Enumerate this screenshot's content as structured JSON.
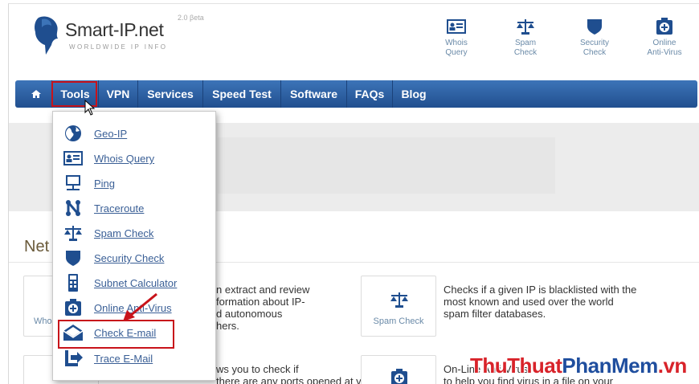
{
  "header": {
    "logo_title": "Smart-IP.net",
    "logo_subtitle": "WORLDWIDE IP INFO",
    "version": "2.0 βeta",
    "links": [
      {
        "label_line1": "Whois",
        "label_line2": "Query",
        "icon": "id-card-icon"
      },
      {
        "label_line1": "Spam",
        "label_line2": "Check",
        "icon": "scales-icon"
      },
      {
        "label_line1": "Security",
        "label_line2": "Check",
        "icon": "shield-icon"
      },
      {
        "label_line1": "Online",
        "label_line2": "Anti-Virus",
        "icon": "virus-scan-icon"
      }
    ]
  },
  "nav": {
    "home_icon": "home-icon",
    "items": [
      "Tools",
      "VPN",
      "Services",
      "Speed Test",
      "Software",
      "FAQs",
      "Blog"
    ]
  },
  "page": {
    "section_title": "Net",
    "box1_label": "Who",
    "desc1": [
      "n extract and review",
      "formation about IP-",
      "d autonomous",
      "hers."
    ],
    "box2_label": "Spam Check",
    "desc2": [
      "Checks if a given IP is blacklisted with the",
      "most known and used over the world",
      "spam filter databases."
    ],
    "desc3": [
      "ws you to check if",
      "there are any ports opened at your"
    ],
    "desc4": [
      "On-Line Anti-Virus",
      "to help you find virus in a file on your"
    ]
  },
  "dropdown": {
    "items": [
      {
        "label": "Geo-IP",
        "icon": "globe-icon"
      },
      {
        "label": "Whois Query",
        "icon": "id-card-icon"
      },
      {
        "label": "Ping",
        "icon": "monitor-icon"
      },
      {
        "label": "Traceroute",
        "icon": "route-icon"
      },
      {
        "label": "Spam Check",
        "icon": "scales-icon"
      },
      {
        "label": "Security Check",
        "icon": "shield-icon"
      },
      {
        "label": "Subnet Calculator",
        "icon": "calculator-icon"
      },
      {
        "label": "Online Anti-Virus",
        "icon": "virus-scan-icon"
      },
      {
        "label": "Check E-mail",
        "icon": "envelope-icon"
      },
      {
        "label": "Trace E-Mail",
        "icon": "trace-mail-icon"
      }
    ]
  },
  "watermark": {
    "part1": "ThuThuat",
    "part2": "PhanMem",
    "part3": ".vn"
  },
  "colors": {
    "nav_top": "#3c74b8",
    "nav_bottom": "#214f8f",
    "link": "#3a5f96",
    "highlight": "#c8131a",
    "icon": "#1f4e8f"
  }
}
